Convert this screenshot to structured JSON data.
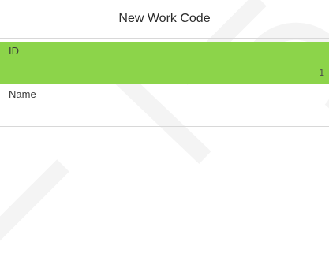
{
  "header": {
    "title": "New Work Code"
  },
  "form": {
    "fields": [
      {
        "label": "ID",
        "value": "1",
        "selected": true
      },
      {
        "label": "Name",
        "value": ""
      }
    ]
  },
  "colors": {
    "selected_row": "#8cd44a",
    "divider": "#d8d8d8",
    "background": "#ffffff"
  }
}
